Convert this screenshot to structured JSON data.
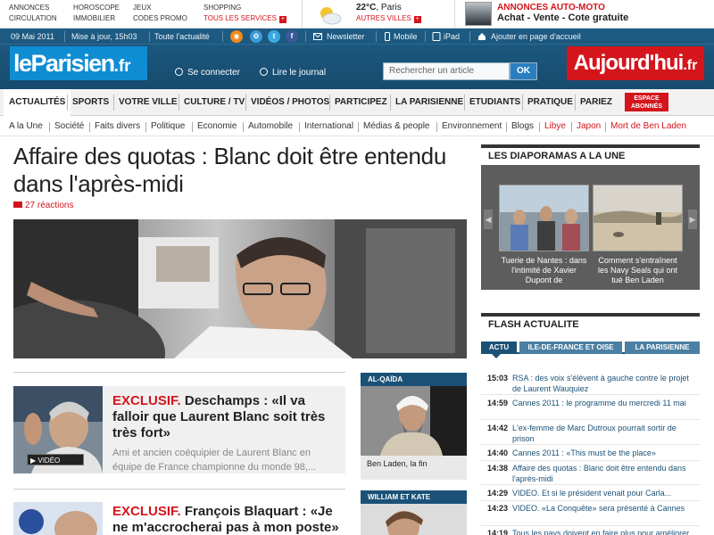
{
  "topbar": {
    "col1": [
      "Annonces",
      "Circulation"
    ],
    "col2": [
      "Horoscope",
      "Immobilier"
    ],
    "col3": [
      "Jeux",
      "Codes promo"
    ],
    "col4_top": "Shopping",
    "col4_link": "Tous les services",
    "weather_temp": "22°C",
    "weather_city": "Paris",
    "weather_link": "Autres villes",
    "auto_title": "Annonces auto-moto",
    "auto_sub": "Achat - Vente - Cote gratuite"
  },
  "header": {
    "date": "09 Mai 2011",
    "update": "Mise à jour, 15h03",
    "all_news": "Toute l'actualité",
    "newsletter": "Newsletter",
    "mobile": "Mobile",
    "ipad": "iPad",
    "homepage": "Ajouter en page d'accueil",
    "logo_main": "leParisien",
    "logo_tld": ".fr",
    "connect": "Se connecter",
    "read_journal": "Lire le journal",
    "search_placeholder": "Rechercher un article",
    "search_button": "OK",
    "aujourdhui_main": "Aujourd'hui",
    "aujourdhui_tld": ".fr"
  },
  "nav": {
    "items": [
      "Actualités",
      "Sports",
      "Votre ville",
      "Culture / TV",
      "Vidéos / Photos",
      "Participez",
      "La Parisienne",
      "Etudiants",
      "Pratique",
      "Pariez"
    ],
    "espace_line1": "Espace",
    "espace_line2": "abonnés"
  },
  "subnav": {
    "items": [
      "A la Une",
      "Société",
      "Faits divers",
      "Politique",
      "Economie",
      "Automobile",
      "International",
      "Médias & people",
      "Environnement",
      "Blogs",
      "Libye",
      "Japon",
      "Mort de Ben Laden"
    ]
  },
  "main": {
    "headline": "Affaire des quotas : Blanc doit être entendu dans l'après-midi",
    "reactions": "27 réactions",
    "article1": {
      "tag": "EXCLUSIF.",
      "title": "Deschamps : «Il va falloir que Laurent Blanc soit très très fort»",
      "summary": "Ami et ancien coéquipier de Laurent Blanc en équipe de France championne du monde 98,...",
      "video": "VIDÉO"
    },
    "article2": {
      "tag": "EXCLUSIF.",
      "title": "François Blaquart : «Je ne m'accrocherai pas à mon poste»"
    },
    "box1": {
      "head": "Al-Qaïda",
      "caption": "Ben Laden, la fin"
    },
    "box2": {
      "head": "William et Kate"
    }
  },
  "sidebar": {
    "diapo_title": "Les diaporamas a la une",
    "diapo": [
      "Tuerie de Nantes : dans l'intimité de Xavier Dupont de",
      "Comment s'entraînent les Navy Seals qui ont tué Ben Laden"
    ],
    "flash_title": "Flash actualite",
    "tabs": [
      "Actu",
      "Ile-de-France et Oise",
      "La Parisienne"
    ],
    "news": [
      {
        "time": "15:03",
        "text": "RSA : des voix s'élèvent à gauche contre le projet de Laurent Wauquiez"
      },
      {
        "time": "14:59",
        "text": "Cannes 2011 : le programme du mercredi 11 mai"
      },
      {
        "time": "14:42",
        "text": "L'ex-femme de Marc Dutroux pourrait sortir de prison"
      },
      {
        "time": "14:40",
        "text": "Cannes 2011 : «This must be the place»"
      },
      {
        "time": "14:38",
        "text": "Affaire des quotas : Blanc doit être entendu dans l'après-midi"
      },
      {
        "time": "14:29",
        "text": "VIDEO. Et si le président venait pour Carla..."
      },
      {
        "time": "14:23",
        "text": "VIDEO. «La Conquête» sera présenté à Cannes"
      },
      {
        "time": "14:19",
        "text": "Tous les pays doivent en faire plus pour améliorer"
      }
    ]
  },
  "colors": {
    "brand_blue": "#1b5177",
    "logo_blue": "#0f8dd3",
    "red": "#d4151c"
  }
}
